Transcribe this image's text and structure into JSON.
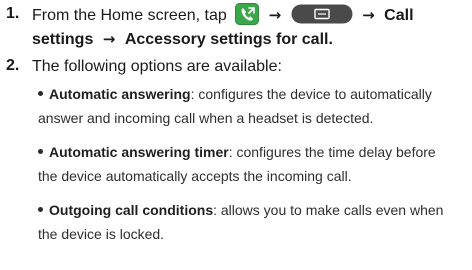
{
  "step1": {
    "number": "1.",
    "text_start": "From the Home screen, tap",
    "phone_icon": "phone-icon",
    "menu_icon": "menu-key-icon",
    "arrow1": "→",
    "arrow2": "→",
    "arrow3": "→",
    "call_word": "Call",
    "line2_part1": "settings",
    "line2_part2": "Accessory settings for call",
    "line2_end": "."
  },
  "step2": {
    "number": "2.",
    "text": "The following options are available:"
  },
  "options": [
    {
      "term": "Automatic answering",
      "desc_line1": ": configures the device to automatically",
      "desc_line2": "answer and incoming call when a headset is detected."
    },
    {
      "term": "Automatic answering timer",
      "desc_line1": ": configures the time delay before",
      "desc_line2": "the device automatically accepts the incoming call."
    },
    {
      "term": "Outgoing call conditions",
      "desc_line1": ": allows you to make calls even when",
      "desc_line2": "the device is locked."
    }
  ],
  "colors": {
    "text": "#1a1a1a",
    "phone_icon_green": "#3aa84a",
    "menu_key_bg": "#4a4a4a"
  }
}
